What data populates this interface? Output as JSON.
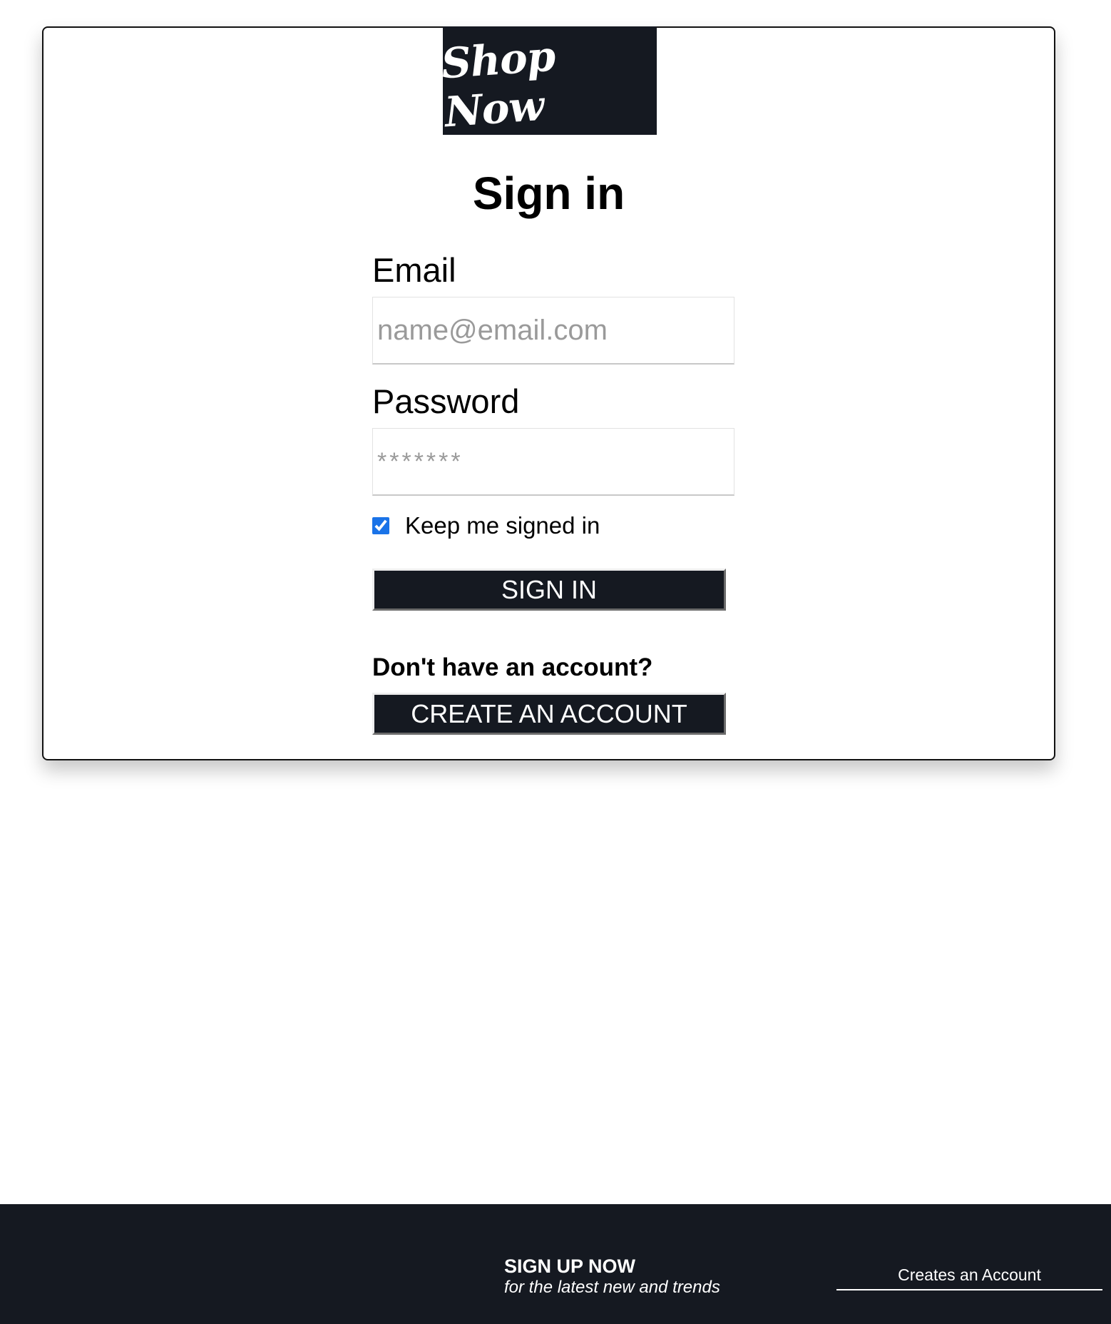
{
  "brand": {
    "logo_text": "Shop Now",
    "logo_bg": "#151921"
  },
  "form": {
    "title": "Sign in",
    "email_label": "Email",
    "email_placeholder": "name@email.com",
    "email_value": "",
    "password_label": "Password",
    "password_placeholder": "*******",
    "password_value": "",
    "keep_signed_in_label": "Keep me signed in",
    "keep_signed_in_checked": true,
    "sign_in_button": "SIGN IN",
    "no_account_text": "Don't have an account?",
    "create_account_button": "CREATE AN ACCOUNT"
  },
  "footer": {
    "signup_heading": "SIGN UP NOW",
    "signup_subtext": "for the latest new and trends",
    "account_link": "Creates an Account"
  },
  "colors": {
    "button_bg": "#151921",
    "footer_bg": "#151921",
    "checkbox_accent": "#1a73e8"
  }
}
